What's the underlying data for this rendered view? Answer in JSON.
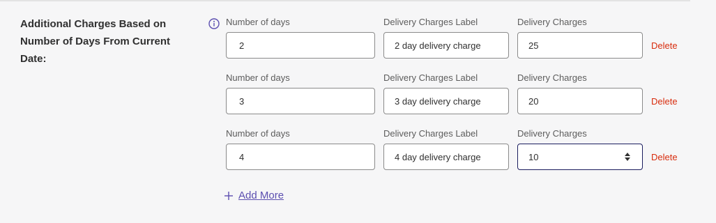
{
  "section": {
    "label": "Additional Charges Based on Number of Days From Current Date:",
    "info_icon": "info-circle-icon"
  },
  "rows": [
    {
      "days_label": "Number of days",
      "days_value": "2",
      "charge_label_label": "Delivery Charges Label",
      "charge_label_value": "2 day delivery charge",
      "charge_label": "Delivery Charges",
      "charge_value": "25",
      "delete_label": "Delete"
    },
    {
      "days_label": "Number of days",
      "days_value": "3",
      "charge_label_label": "Delivery Charges Label",
      "charge_label_value": "3 day delivery charge",
      "charge_label": "Delivery Charges",
      "charge_value": "20",
      "delete_label": "Delete"
    },
    {
      "days_label": "Number of days",
      "days_value": "4",
      "charge_label_label": "Delivery Charges Label",
      "charge_label_value": "4 day delivery charge",
      "charge_label": "Delivery Charges",
      "charge_value": "10",
      "delete_label": "Delete"
    }
  ],
  "add_more": {
    "label": "Add More",
    "icon": "plus-icon"
  },
  "colors": {
    "delete": "#d82c0d",
    "link": "#5c4fb0",
    "focus_border": "#1a1c5e",
    "info_icon": "#5c4fb0"
  }
}
